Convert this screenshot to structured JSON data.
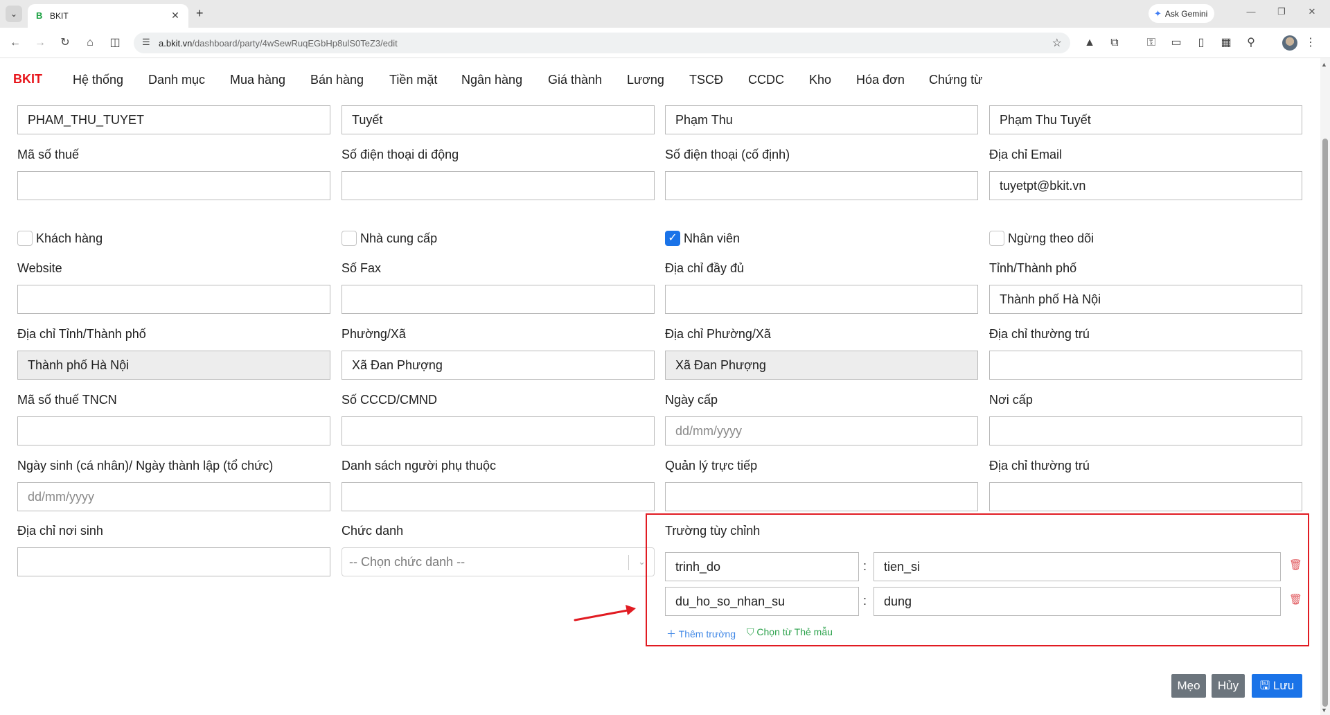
{
  "browser": {
    "tab_title": "BKIT",
    "tab_favicon": "B",
    "url_domain": "a.bkit.vn",
    "url_path": "/dashboard/party/4wSewRuqEGbHp8ulS0TeZ3/edit",
    "ask_gemini": "Ask Gemini"
  },
  "nav": {
    "brand": "BKIT",
    "items": [
      "Hệ thống",
      "Danh mục",
      "Mua hàng",
      "Bán hàng",
      "Tiền mặt",
      "Ngân hàng",
      "Giá thành",
      "Lương",
      "TSCĐ",
      "CCDC",
      "Kho",
      "Hóa đơn",
      "Chứng từ"
    ]
  },
  "form": {
    "top_row": [
      "PHAM_THU_TUYET",
      "Tuyết",
      "Phạm Thu",
      "Phạm Thu Tuyết"
    ],
    "row2_labels": [
      "Mã số thuế",
      "Số điện thoại di động",
      "Số điện thoại (cố định)",
      "Địa chỉ Email"
    ],
    "row2_values": [
      "",
      "",
      "",
      "tuyetpt@bkit.vn"
    ],
    "checkboxes": [
      {
        "label": "Khách hàng",
        "checked": false
      },
      {
        "label": "Nhà cung cấp",
        "checked": false
      },
      {
        "label": "Nhân viên",
        "checked": true
      },
      {
        "label": "Ngừng theo dõi",
        "checked": false
      }
    ],
    "row3_labels": [
      "Website",
      "Số Fax",
      "Địa chỉ đầy đủ",
      "Tỉnh/Thành phố"
    ],
    "row3_values": [
      "",
      "",
      "",
      "Thành phố Hà Nội"
    ],
    "row4_labels": [
      "Địa chỉ Tỉnh/Thành phố",
      "Phường/Xã",
      "Địa chỉ Phường/Xã",
      "Địa chỉ thường trú"
    ],
    "row4_values": [
      "Thành phố Hà Nội",
      "Xã Đan Phượng",
      "Xã Đan Phượng",
      ""
    ],
    "row5_labels": [
      "Mã số thuế TNCN",
      "Số CCCD/CMND",
      "Ngày cấp",
      "Nơi cấp"
    ],
    "row5_values": [
      "",
      "",
      "",
      ""
    ],
    "row5_placeholders": [
      "",
      "",
      "dd/mm/yyyy",
      ""
    ],
    "row6_labels": [
      "Ngày sinh (cá nhân)/ Ngày thành lập (tổ chức)",
      "Danh sách người phụ thuộc",
      "Quản lý trực tiếp",
      "Địa chỉ thường trú"
    ],
    "row6_values": [
      "",
      "",
      "",
      ""
    ],
    "row6_placeholders": [
      "dd/mm/yyyy",
      "",
      "",
      ""
    ],
    "row7_labels": [
      "Địa chỉ nơi sinh",
      "Chức danh"
    ],
    "birthplace_value": "",
    "position_placeholder": "-- Chọn chức danh --"
  },
  "custom_fields": {
    "title": "Trường tùy chỉnh",
    "rows": [
      {
        "key": "trinh_do",
        "value": "tien_si"
      },
      {
        "key": "du_ho_so_nhan_su",
        "value": "dung"
      }
    ],
    "add_label": "Thêm trường",
    "template_label": "Chọn từ Thẻ mẫu"
  },
  "actions": {
    "tips": "Mẹo",
    "cancel": "Hủy",
    "save": "Lưu"
  },
  "colors": {
    "brand": "#e7141a",
    "primary": "#1a73e8",
    "highlight_box": "#e11b22",
    "annotation_arrow": "#e11b22",
    "secondary_button": "#6c757d"
  }
}
